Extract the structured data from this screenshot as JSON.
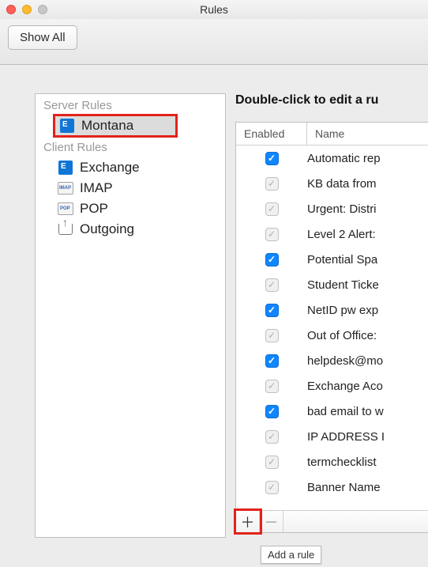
{
  "window": {
    "title": "Rules"
  },
  "toolbar": {
    "show_all": "Show All"
  },
  "sidebar": {
    "server_header": "Server Rules",
    "client_header": "Client Rules",
    "items": [
      {
        "label": "Montana"
      },
      {
        "label": "Exchange"
      },
      {
        "label": "IMAP"
      },
      {
        "label": "POP"
      },
      {
        "label": "Outgoing"
      }
    ]
  },
  "rules": {
    "instruction": "Double-click to edit a ru",
    "headers": {
      "enabled": "Enabled",
      "name": "Name"
    },
    "rows": [
      {
        "enabled": true,
        "name": "Automatic rep"
      },
      {
        "enabled": false,
        "name": "KB data from"
      },
      {
        "enabled": false,
        "name": "Urgent: Distri"
      },
      {
        "enabled": false,
        "name": "Level 2 Alert:"
      },
      {
        "enabled": true,
        "name": "Potential Spa"
      },
      {
        "enabled": false,
        "name": "Student Ticke"
      },
      {
        "enabled": true,
        "name": "NetID pw exp"
      },
      {
        "enabled": false,
        "name": "Out of Office:"
      },
      {
        "enabled": true,
        "name": "helpdesk@mo"
      },
      {
        "enabled": false,
        "name": "Exchange Aco"
      },
      {
        "enabled": true,
        "name": "bad email to w"
      },
      {
        "enabled": false,
        "name": "IP ADDRESS I"
      },
      {
        "enabled": false,
        "name": "termchecklist"
      },
      {
        "enabled": false,
        "name": "Banner Name"
      }
    ]
  },
  "tooltip": "Add a rule"
}
